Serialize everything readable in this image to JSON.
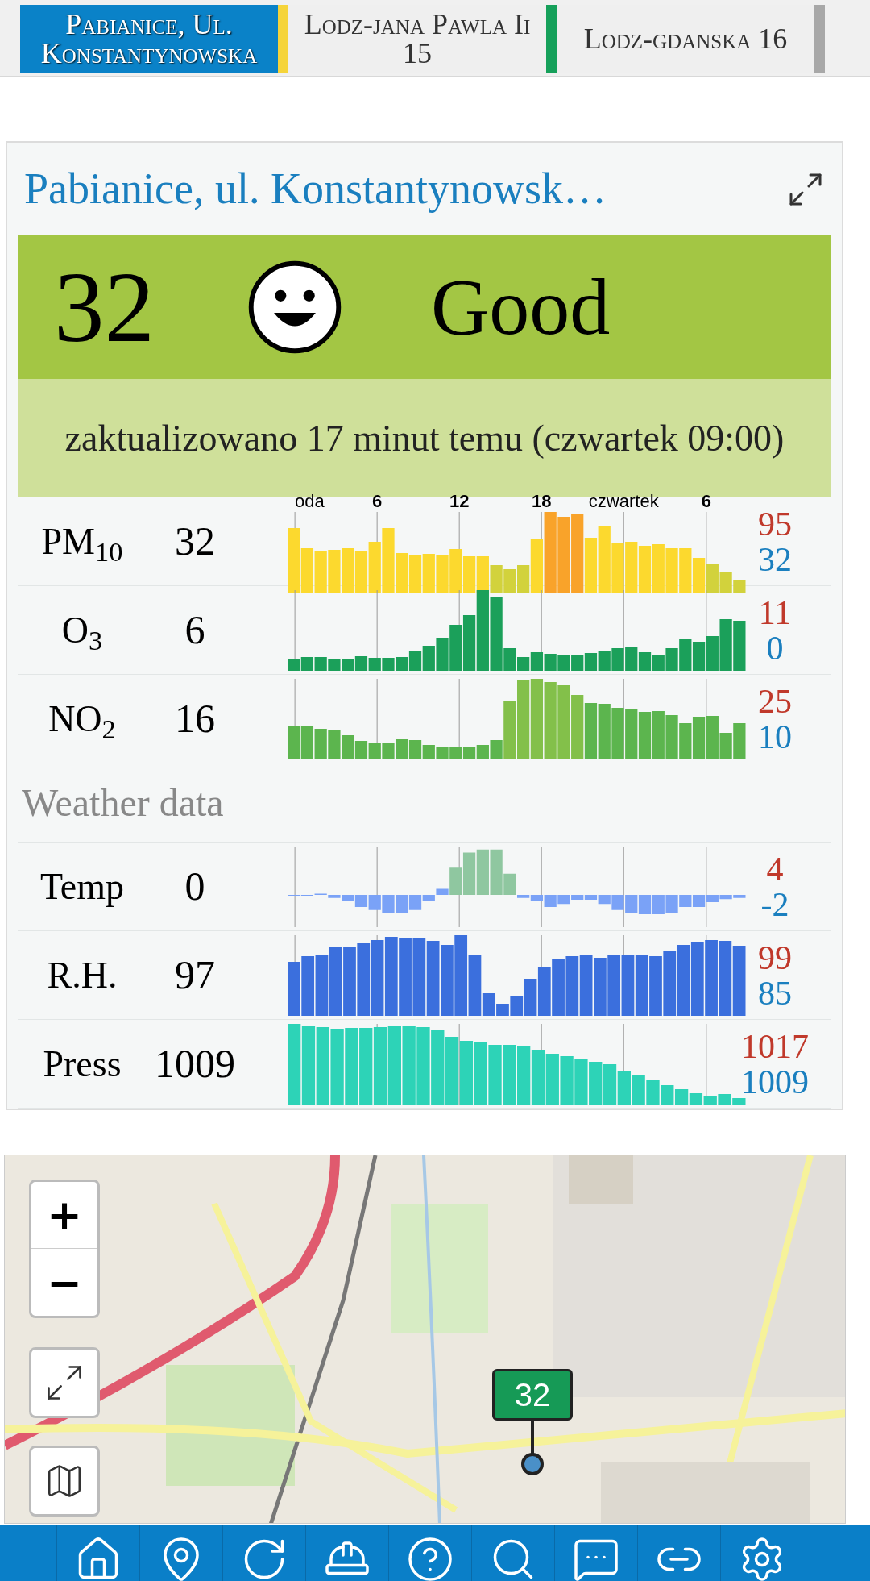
{
  "tabs": [
    {
      "label": "Pabianice, Ul. Konstantynowska",
      "selected": true,
      "color": "#f5d43a"
    },
    {
      "label": "Lodz-jana Pawla Ii 15",
      "selected": false,
      "color": "#16a05a"
    },
    {
      "label": "Lodz-gdanska 16",
      "selected": false,
      "color": "#a8a8a8"
    }
  ],
  "station": {
    "title": "Pabianice, ul. Konstantynowsk…",
    "aqi": "32",
    "status": "Good",
    "updated": "zaktualizowano 17 minut temu (czwartek 09:00)"
  },
  "axis_labels": [
    {
      "text": "oda",
      "kind": "day"
    },
    {
      "text": "6",
      "kind": "hour"
    },
    {
      "text": "12",
      "kind": "hour"
    },
    {
      "text": "18",
      "kind": "hour"
    },
    {
      "text": "czwartek",
      "kind": "day"
    },
    {
      "text": "6",
      "kind": "hour"
    }
  ],
  "pollutants": [
    {
      "name": "PM$_{10}$",
      "value": "32",
      "max": "95",
      "min": "32"
    },
    {
      "name": "O$_{3}$",
      "value": "6",
      "max": "11",
      "min": "0"
    },
    {
      "name": "NO$_{2}$",
      "value": "16",
      "max": "25",
      "min": "10"
    }
  ],
  "weather_heading": "Weather data",
  "weather": [
    {
      "name": "Temp",
      "value": "0",
      "max": "4",
      "min": "-2",
      "kind": "diverging"
    },
    {
      "name": "R.H.",
      "value": "97",
      "max": "99",
      "min": "85",
      "kind": "bars"
    },
    {
      "name": "Press",
      "value": "1009",
      "max": "1017",
      "min": "1009",
      "kind": "bars"
    }
  ],
  "map": {
    "marker": "32",
    "zoom_in": "+",
    "zoom_out": "−"
  }
}
